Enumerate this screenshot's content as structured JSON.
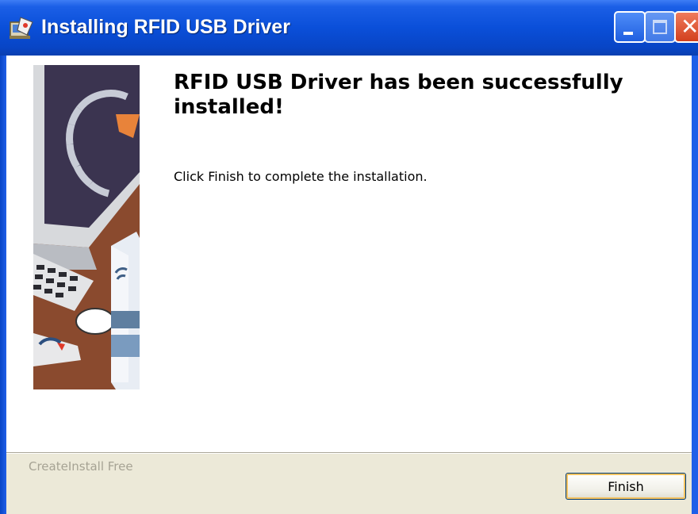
{
  "window": {
    "title": "Installing RFID USB Driver"
  },
  "titlebar": {
    "icon": "installer-icon",
    "buttons": [
      "minimize-icon",
      "maximize-icon",
      "close-icon"
    ]
  },
  "content": {
    "heading": "RFID USB Driver has been successfully installed!",
    "description": "Click Finish to complete the installation."
  },
  "footer": {
    "brand": "CreateInstall Free",
    "finish_label": "Finish"
  },
  "colors": {
    "titlebar": "#0a4fd9",
    "close_button": "#d2401e",
    "footer_bg": "#ece9d8",
    "button_focus": "#f4c25f"
  }
}
